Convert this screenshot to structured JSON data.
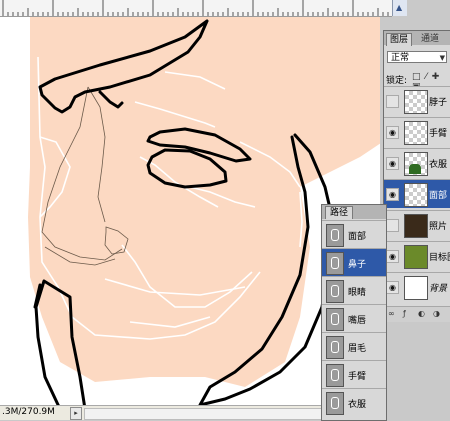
{
  "status": {
    "doc_size": ".3M/270.9M",
    "arrow": "▸"
  },
  "layers_panel": {
    "tabs": [
      "图层",
      "通道"
    ],
    "blend_mode": "正常",
    "lock_label": "锁定:",
    "lock_icons": "□ ⁄ ✚ ▣",
    "layers": [
      {
        "name": "脖子",
        "visible": false,
        "thumb": "checker",
        "selected": false
      },
      {
        "name": "手臂",
        "visible": true,
        "thumb": "checker",
        "selected": false
      },
      {
        "name": "衣服",
        "visible": true,
        "thumb": "cloth",
        "selected": false
      },
      {
        "name": "面部",
        "visible": true,
        "thumb": "checker",
        "selected": true
      },
      {
        "name": "照片",
        "visible": false,
        "thumb": "photo",
        "selected": false
      },
      {
        "name": "目标图",
        "visible": true,
        "thumb": "target",
        "selected": false
      },
      {
        "name": "背景",
        "visible": true,
        "thumb": "bg",
        "selected": false,
        "italic": true
      }
    ],
    "footer_icons": [
      "link-icon",
      "fx-icon",
      "mask-icon",
      "adjust-icon"
    ],
    "footer_glyphs": [
      "∞",
      "ƒ",
      "◐",
      "◑"
    ]
  },
  "paths_panel": {
    "title": "路径",
    "paths": [
      {
        "name": "面部",
        "selected": false
      },
      {
        "name": "鼻子",
        "selected": true
      },
      {
        "name": "眼睛",
        "selected": false
      },
      {
        "name": "嘴唇",
        "selected": false
      },
      {
        "name": "眉毛",
        "selected": false
      },
      {
        "name": "手臂",
        "selected": false
      },
      {
        "name": "衣服",
        "selected": false
      }
    ]
  },
  "colors": {
    "skin": "#fcd9c2",
    "selection": "#2e59a8",
    "panel": "#d8d8d8"
  }
}
